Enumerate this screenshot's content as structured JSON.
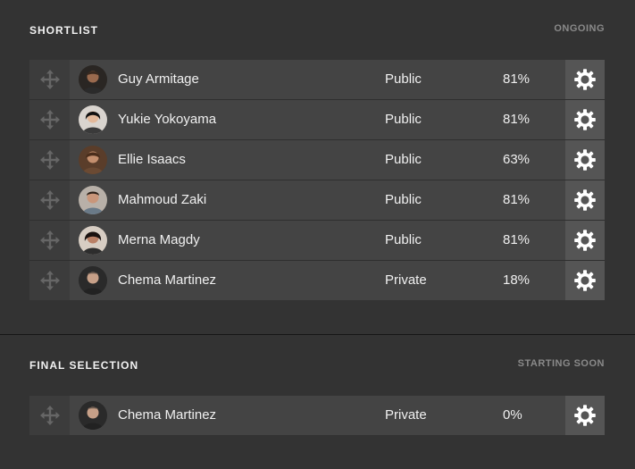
{
  "colors": {
    "background": "#333333",
    "row": "#444444",
    "drag_cell": "#3c3c3c",
    "settings_cell": "#555555",
    "status_text": "#8a8a8a"
  },
  "shortlist": {
    "title": "SHORTLIST",
    "status": "ONGOING",
    "rows": [
      {
        "name": "Guy Armitage",
        "visibility": "Public",
        "percent": "81%",
        "avatar_icon": "person-avatar"
      },
      {
        "name": "Yukie Yokoyama",
        "visibility": "Public",
        "percent": "81%",
        "avatar_icon": "person-avatar"
      },
      {
        "name": "Ellie Isaacs",
        "visibility": "Public",
        "percent": "63%",
        "avatar_icon": "person-avatar"
      },
      {
        "name": "Mahmoud Zaki",
        "visibility": "Public",
        "percent": "81%",
        "avatar_icon": "person-avatar"
      },
      {
        "name": "Merna Magdy",
        "visibility": "Public",
        "percent": "81%",
        "avatar_icon": "person-avatar"
      },
      {
        "name": "Chema Martinez",
        "visibility": "Private",
        "percent": "18%",
        "avatar_icon": "person-avatar"
      }
    ]
  },
  "final_selection": {
    "title": "FINAL SELECTION",
    "status": "STARTING SOON",
    "rows": [
      {
        "name": "Chema Martinez",
        "visibility": "Private",
        "percent": "0%",
        "avatar_icon": "person-avatar"
      }
    ]
  },
  "icons": {
    "drag": "move-arrows-icon",
    "settings": "gear-icon"
  }
}
